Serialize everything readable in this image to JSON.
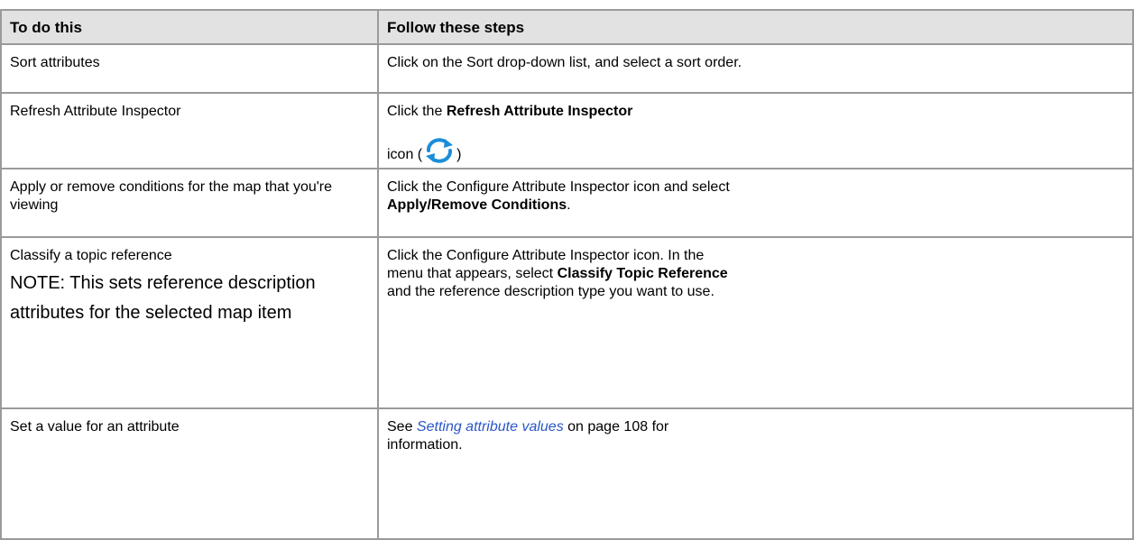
{
  "table": {
    "headers": {
      "col1": "To do this",
      "col2": "Follow these steps"
    },
    "rows": [
      {
        "task": "Sort attributes",
        "steps": "Click on the Sort drop-down list, and select a sort order."
      },
      {
        "task": "Refresh Attribute Inspector",
        "steps_pre": "Click the",
        "steps_bold": "Refresh Attribute Inspector",
        "icon_pre": "icon (",
        "icon_post": ")",
        "icon": "refresh-icon",
        "icon_color": "#1a8ed8"
      },
      {
        "task": "Apply or remove conditions for the map that you're viewing",
        "steps_pre": "Click the Configure Attribute Inspector icon and select",
        "steps_bold": "Apply/Remove Conditions",
        "steps_post": "."
      },
      {
        "task": "Classify a topic reference",
        "note": "NOTE: This sets reference description attributes for the selected map item",
        "steps_pre": "Click the Configure Attribute Inspector icon. In the menu that appears, select",
        "steps_bold": "Classify Topic Reference",
        "steps_post": "and the reference description type you want to use."
      },
      {
        "task": "Set a value for an attribute",
        "steps_pre": "See",
        "steps_link": "Setting attribute values",
        "steps_post": "on page 108 for information."
      }
    ]
  },
  "colors": {
    "header_bg": "#e2e2e2",
    "border": "#9a9a9a",
    "link": "#2a57c7"
  }
}
